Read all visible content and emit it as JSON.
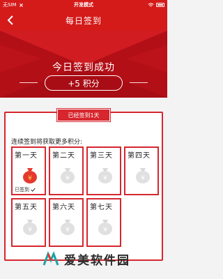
{
  "status_bar": {
    "carrier": "无SIM",
    "title": "开发模式",
    "time": ""
  },
  "nav": {
    "title": "每日签到"
  },
  "hero": {
    "message": "今日签到成功",
    "points": "+5 积分"
  },
  "card": {
    "banner": "已经签到1天",
    "streak_text": "连续签到将获取更多积分:",
    "days": [
      {
        "label": "第一天",
        "status": "已签到",
        "signed": true
      },
      {
        "label": "第二天",
        "signed": false
      },
      {
        "label": "第三天",
        "signed": false
      },
      {
        "label": "第四天",
        "signed": false
      },
      {
        "label": "第五天",
        "signed": false
      },
      {
        "label": "第六天",
        "signed": false
      },
      {
        "label": "第七天",
        "signed": false
      }
    ]
  },
  "watermark": {
    "text": "爱美软件园"
  },
  "colors": {
    "brand_red": "#d51a1a",
    "card_border": "#d7262e",
    "coin_bag": "#e0e0e0",
    "signed_bag": "#e43a2e"
  },
  "icons": [
    "back-icon",
    "wifi-icon",
    "battery-icon",
    "money-bag-icon",
    "check-icon",
    "logo-icon"
  ]
}
